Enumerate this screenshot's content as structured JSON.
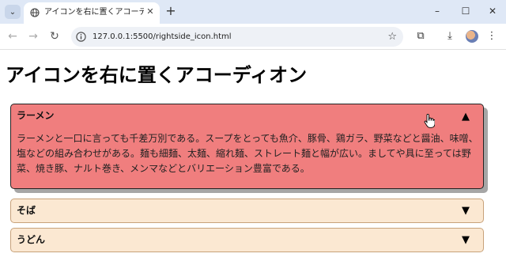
{
  "browser": {
    "tab_title": "アイコンを右に置くアコーディオン",
    "url": "127.0.0.1:5500/rightside_icon.html"
  },
  "page": {
    "heading": "アイコンを右に置くアコーディオン",
    "accordion": [
      {
        "label": "ラーメン",
        "open": true,
        "content": "ラーメンと一口に言っても千差万別である。スープをとっても魚介、豚骨、鶏ガラ、野菜などと醤油、味噌、塩などの組み合わせがある。麺も細麺、太麺、縮れ麺、ストレート麺と幅が広い。ましてや具に至っては野菜、焼き豚、ナルト巻き、メンマなどとバリエーション豊富である。",
        "arrow": "▲"
      },
      {
        "label": "そば",
        "open": false,
        "arrow": "▼"
      },
      {
        "label": "うどん",
        "open": false,
        "arrow": "▼"
      }
    ]
  },
  "icons": {
    "tab_search": "chevron-down-icon",
    "favicon": "globe-icon",
    "site_info": "info-icon",
    "bookmark": "star-icon",
    "extensions": "puzzle-icon",
    "downloads": "download-icon",
    "menu": "more-vert-icon"
  }
}
